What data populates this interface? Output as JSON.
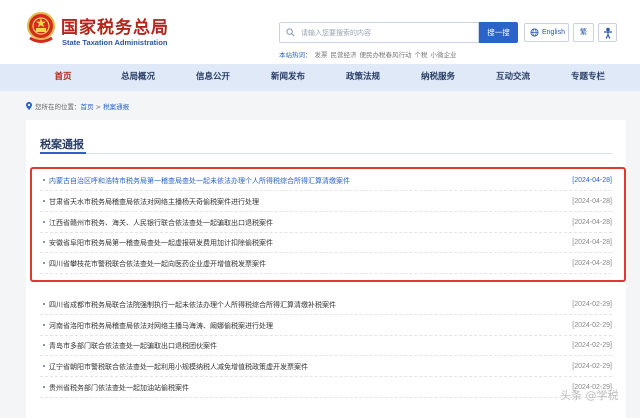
{
  "header": {
    "logo_cn": "国家税务总局",
    "logo_en": "State Taxation Administration",
    "search_placeholder": "请输入您要搜索的内容",
    "search_button": "搜一搜",
    "lang_button": "English",
    "trad_button": "繁",
    "hot_label": "本站热词：",
    "hot_words": [
      "发票",
      "民营经济",
      "便民办税春风行动",
      "个税",
      "小微企业"
    ]
  },
  "nav": {
    "items": [
      "首页",
      "总局概况",
      "信息公开",
      "新闻发布",
      "政策法规",
      "纳税服务",
      "互动交流",
      "专题专栏"
    ],
    "active_index": 0
  },
  "breadcrumb": {
    "label": "您所在的位置：",
    "home": "首页",
    "separator": ">",
    "current": "税案通报"
  },
  "panel": {
    "title": "税案通报"
  },
  "articles": [
    {
      "title": "内蒙古自治区呼和浩特市税务局第一稽查局查处一起未依法办理个人所得税综合所得汇算清缴案件",
      "date": "[2024-04-28]"
    },
    {
      "title": "甘肃省天水市税务局稽查局依法对网络主播杨天奇偷税案件进行处理",
      "date": "[2024-04-28]"
    },
    {
      "title": "江西省赣州市税务、海关、人民银行联合依法查处一起骗取出口退税案件",
      "date": "[2024-04-28]"
    },
    {
      "title": "安徽省阜阳市税务局第一稽查局查处一起虚报研发费用加计扣除偷税案件",
      "date": "[2024-04-28]"
    },
    {
      "title": "四川省攀枝花市警税联合依法查处一起向医药企业虚开增值税发票案件",
      "date": "[2024-04-28]"
    },
    {
      "title": "四川省成都市税务局联合法院强制执行一起未依法办理个人所得税综合所得汇算清缴补税案件",
      "date": "[2024-02-29]"
    },
    {
      "title": "河南省洛阳市税务局稽查局依法对网络主播马海涛、阚娜偷税案进行处理",
      "date": "[2024-02-29]"
    },
    {
      "title": "青岛市多部门联合依法查处一起骗取出口退税团伙案件",
      "date": "[2024-02-29]"
    },
    {
      "title": "辽宁省朝阳市警税联合依法查处一起利用小规模纳税人减免增值税政策虚开发票案件",
      "date": "[2024-02-29]"
    },
    {
      "title": "贵州省税务部门依法查处一起加油站偷税案件",
      "date": "[2024-02-29]"
    }
  ],
  "watermark": "头条 @学税",
  "colors": {
    "brand_red": "#b3251b",
    "brand_blue": "#2b63c8",
    "nav_bg": "#dfe9f8",
    "highlight_border": "#e03a2f"
  }
}
